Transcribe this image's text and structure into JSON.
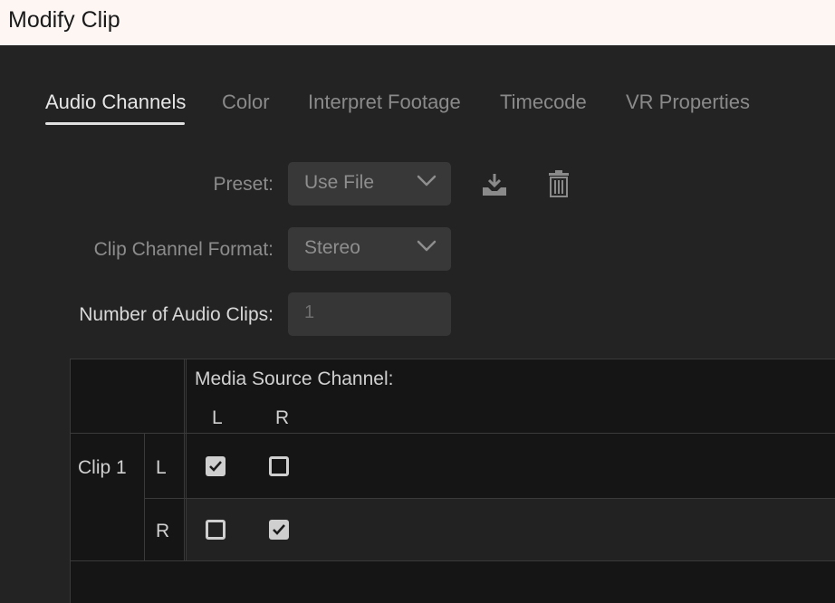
{
  "window": {
    "title": "Modify Clip"
  },
  "tabs": [
    {
      "label": "Audio Channels",
      "active": true
    },
    {
      "label": "Color",
      "active": false
    },
    {
      "label": "Interpret Footage",
      "active": false
    },
    {
      "label": "Timecode",
      "active": false
    },
    {
      "label": "VR Properties",
      "active": false
    }
  ],
  "form": {
    "preset_label": "Preset:",
    "preset_value": "Use File",
    "channel_format_label": "Clip Channel Format:",
    "channel_format_value": "Stereo",
    "num_clips_label": "Number of Audio Clips:",
    "num_clips_value": "1"
  },
  "icons": {
    "save_preset": "download-icon",
    "delete_preset": "trash-icon",
    "dropdown": "chevron-down-icon"
  },
  "grid": {
    "header": "Media Source Channel:",
    "source_channels": [
      "L",
      "R"
    ],
    "clips": [
      {
        "name": "Clip 1",
        "channels": [
          {
            "label": "L",
            "checks": [
              true,
              false
            ]
          },
          {
            "label": "R",
            "checks": [
              false,
              true
            ]
          }
        ]
      }
    ]
  },
  "colors": {
    "background": "#232323",
    "titlebar": "#fdf6f3",
    "active_tab": "#e6e6e6",
    "inactive_tab": "#8a8a8a",
    "field": "#383838"
  }
}
